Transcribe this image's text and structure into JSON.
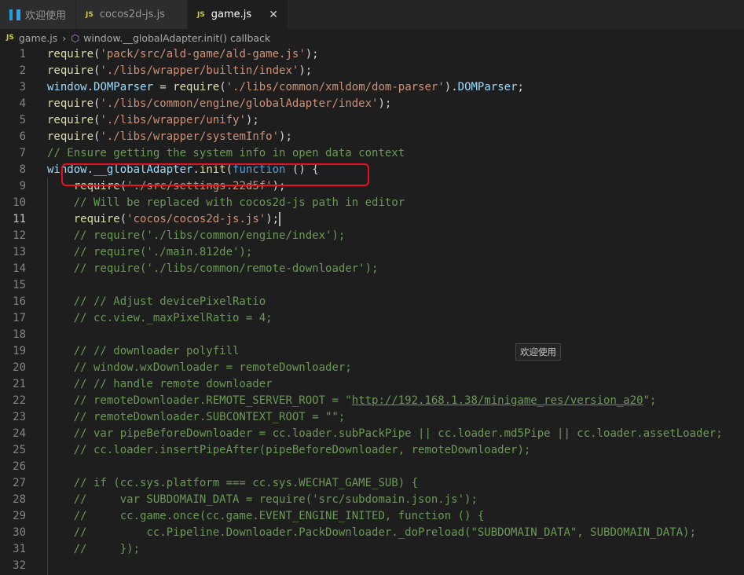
{
  "tabs": [
    {
      "label": "欢迎使用",
      "icon": "vscode-logo-icon"
    },
    {
      "label": "cocos2d-js.js",
      "icon": "js-file-icon",
      "badge": "JS"
    },
    {
      "label": "game.js",
      "icon": "js-file-icon",
      "badge": "JS",
      "active": true
    }
  ],
  "tab_close": "✕",
  "breadcrumb": {
    "badge": "JS",
    "file": "game.js",
    "separator": "›",
    "symbol": "window.__globalAdapter.init() callback"
  },
  "tooltip": "欢迎使用",
  "current_line": 11,
  "colors": {
    "highlight_box": "#e81123",
    "background": "#1e1e1e"
  },
  "lines": [
    [
      [
        "fn",
        "require"
      ],
      [
        "p",
        "("
      ],
      [
        "str",
        "'pack/src/ald-game/ald-game.js'"
      ],
      [
        "p",
        ");"
      ]
    ],
    [
      [
        "fn",
        "require"
      ],
      [
        "p",
        "("
      ],
      [
        "str",
        "'./libs/wrapper/builtin/index'"
      ],
      [
        "p",
        ");"
      ]
    ],
    [
      [
        "var",
        "window"
      ],
      [
        "p",
        "."
      ],
      [
        "var",
        "DOMParser"
      ],
      [
        "p",
        " = "
      ],
      [
        "fn",
        "require"
      ],
      [
        "p",
        "("
      ],
      [
        "str",
        "'./libs/common/xmldom/dom-parser'"
      ],
      [
        "p",
        ")."
      ],
      [
        "var",
        "DOMParser"
      ],
      [
        "p",
        ";"
      ]
    ],
    [
      [
        "fn",
        "require"
      ],
      [
        "p",
        "("
      ],
      [
        "str",
        "'./libs/common/engine/globalAdapter/index'"
      ],
      [
        "p",
        ");"
      ]
    ],
    [
      [
        "fn",
        "require"
      ],
      [
        "p",
        "("
      ],
      [
        "str",
        "'./libs/wrapper/unify'"
      ],
      [
        "p",
        ");"
      ]
    ],
    [
      [
        "fn",
        "require"
      ],
      [
        "p",
        "("
      ],
      [
        "str",
        "'./libs/wrapper/systemInfo'"
      ],
      [
        "p",
        ");"
      ]
    ],
    [
      [
        "cm",
        "// Ensure getting the system info in open data context"
      ]
    ],
    [
      [
        "var",
        "window"
      ],
      [
        "p",
        "."
      ],
      [
        "var",
        "__globalAdapter"
      ],
      [
        "p",
        "."
      ],
      [
        "fn",
        "init"
      ],
      [
        "p",
        "("
      ],
      [
        "kw",
        "function"
      ],
      [
        "p",
        " () {"
      ]
    ],
    [
      [
        "p",
        "    "
      ],
      [
        "fn",
        "require"
      ],
      [
        "p",
        "("
      ],
      [
        "str",
        "'./src/settings.22d5f'"
      ],
      [
        "p",
        ");"
      ]
    ],
    [
      [
        "p",
        "    "
      ],
      [
        "cm",
        "// Will be replaced with cocos2d-js path in editor"
      ]
    ],
    [
      [
        "p",
        "    "
      ],
      [
        "fn",
        "require"
      ],
      [
        "p",
        "("
      ],
      [
        "str",
        "'cocos/cocos2d-js.js'"
      ],
      [
        "p",
        ");"
      ]
    ],
    [
      [
        "p",
        "    "
      ],
      [
        "cm",
        "// require('./libs/common/engine/index');"
      ]
    ],
    [
      [
        "p",
        "    "
      ],
      [
        "cm",
        "// require('./main.812de');"
      ]
    ],
    [
      [
        "p",
        "    "
      ],
      [
        "cm",
        "// require('./libs/common/remote-downloader');"
      ]
    ],
    [],
    [
      [
        "p",
        "    "
      ],
      [
        "cm",
        "// // Adjust devicePixelRatio"
      ]
    ],
    [
      [
        "p",
        "    "
      ],
      [
        "cm",
        "// cc.view._maxPixelRatio = 4;"
      ]
    ],
    [],
    [
      [
        "p",
        "    "
      ],
      [
        "cm",
        "// // downloader polyfill"
      ]
    ],
    [
      [
        "p",
        "    "
      ],
      [
        "cm",
        "// window.wxDownloader = remoteDownloader;"
      ]
    ],
    [
      [
        "p",
        "    "
      ],
      [
        "cm",
        "// // handle remote downloader"
      ]
    ],
    [
      [
        "p",
        "    "
      ],
      [
        "cm",
        "// remoteDownloader.REMOTE_SERVER_ROOT = \""
      ],
      [
        "link",
        "http://192.168.1.38/minigame_res/version_a20"
      ],
      [
        "cm",
        "\";"
      ]
    ],
    [
      [
        "p",
        "    "
      ],
      [
        "cm",
        "// remoteDownloader.SUBCONTEXT_ROOT = \"\";"
      ]
    ],
    [
      [
        "p",
        "    "
      ],
      [
        "cm",
        "// var pipeBeforeDownloader = cc.loader.subPackPipe || cc.loader.md5Pipe || cc.loader.assetLoader;"
      ]
    ],
    [
      [
        "p",
        "    "
      ],
      [
        "cm",
        "// cc.loader.insertPipeAfter(pipeBeforeDownloader, remoteDownloader);"
      ]
    ],
    [],
    [
      [
        "p",
        "    "
      ],
      [
        "cm",
        "// if (cc.sys.platform === cc.sys.WECHAT_GAME_SUB) {"
      ]
    ],
    [
      [
        "p",
        "    "
      ],
      [
        "cm",
        "//     var SUBDOMAIN_DATA = require('src/subdomain.json.js');"
      ]
    ],
    [
      [
        "p",
        "    "
      ],
      [
        "cm",
        "//     cc.game.once(cc.game.EVENT_ENGINE_INITED, function () {"
      ]
    ],
    [
      [
        "p",
        "    "
      ],
      [
        "cm",
        "//         cc.Pipeline.Downloader.PackDownloader._doPreload(\"SUBDOMAIN_DATA\", SUBDOMAIN_DATA);"
      ]
    ],
    [
      [
        "p",
        "    "
      ],
      [
        "cm",
        "//     });"
      ]
    ],
    []
  ]
}
